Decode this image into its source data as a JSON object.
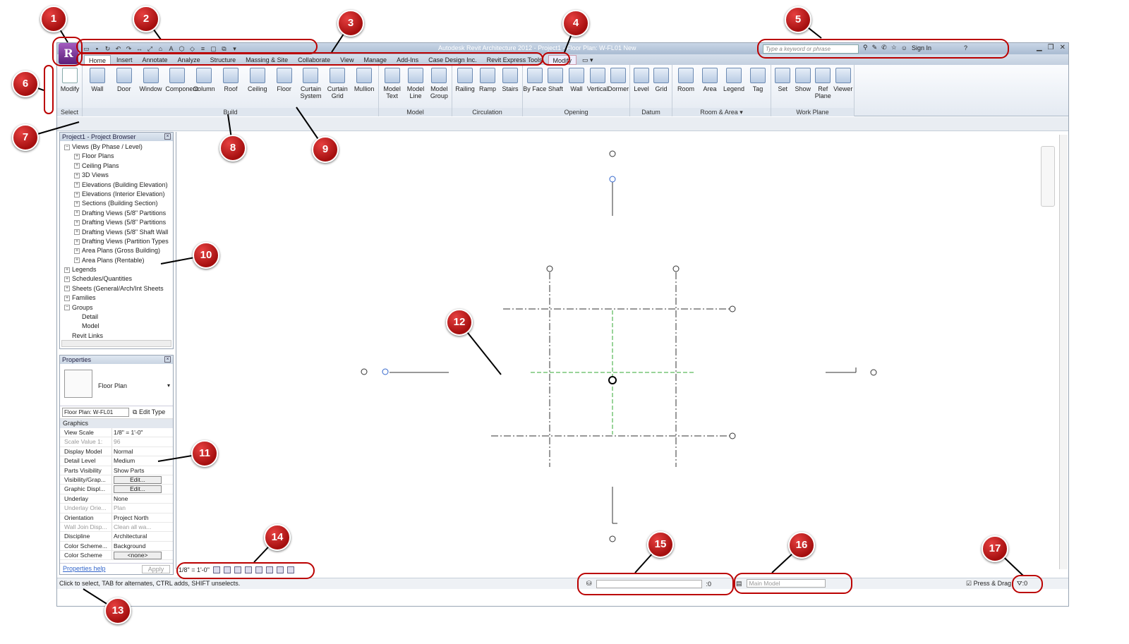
{
  "window": {
    "title": "Autodesk Revit Architecture 2012 -  Project1 - Floor Plan: W-FL01 New",
    "app_button": "R",
    "search_placeholder": "Type a keyword or phrase",
    "sign_in": "Sign In"
  },
  "ribbon_tabs": [
    "Home",
    "Insert",
    "Annotate",
    "Analyze",
    "Structure",
    "Massing & Site",
    "Collaborate",
    "View",
    "Manage",
    "Add-Ins",
    "Case Design Inc.",
    "Revit Express Tools",
    "Modify"
  ],
  "ribbon": {
    "select_tool": "Modify",
    "panels": [
      {
        "title": "Select",
        "tools": [
          "Modify"
        ]
      },
      {
        "title": "Build",
        "tools": [
          "Wall",
          "Door",
          "Window",
          "Component",
          "Column",
          "Roof",
          "Ceiling",
          "Floor",
          "Curtain System",
          "Curtain Grid",
          "Mullion"
        ]
      },
      {
        "title": "Model",
        "tools": [
          "Model Text",
          "Model Line",
          "Model Group"
        ]
      },
      {
        "title": "Circulation",
        "tools": [
          "Railing",
          "Ramp",
          "Stairs"
        ]
      },
      {
        "title": "Opening",
        "tools": [
          "By Face",
          "Shaft",
          "Wall",
          "Vertical",
          "Dormer"
        ]
      },
      {
        "title": "Datum",
        "tools": [
          "Level",
          "Grid"
        ]
      },
      {
        "title": "Room & Area ▾",
        "tools": [
          "Room",
          "Area",
          "Legend",
          "Tag"
        ]
      },
      {
        "title": "Work Plane",
        "tools": [
          "Set",
          "Show",
          "Ref Plane",
          "Viewer"
        ]
      }
    ]
  },
  "project_browser": {
    "title": "Project1 - Project Browser",
    "items": [
      {
        "label": "Views (By Phase / Level)",
        "depth": 0,
        "pm": "−"
      },
      {
        "label": "Floor Plans",
        "depth": 1,
        "pm": "+"
      },
      {
        "label": "Ceiling Plans",
        "depth": 1,
        "pm": "+"
      },
      {
        "label": "3D Views",
        "depth": 1,
        "pm": "+"
      },
      {
        "label": "Elevations (Building Elevation)",
        "depth": 1,
        "pm": "+"
      },
      {
        "label": "Elevations (Interior Elevation)",
        "depth": 1,
        "pm": "+"
      },
      {
        "label": "Sections (Building Section)",
        "depth": 1,
        "pm": "+"
      },
      {
        "label": "Drafting Views (5/8\" Partitions",
        "depth": 1,
        "pm": "+"
      },
      {
        "label": "Drafting Views (5/8\" Partitions",
        "depth": 1,
        "pm": "+"
      },
      {
        "label": "Drafting Views (5/8\" Shaft Wall",
        "depth": 1,
        "pm": "+"
      },
      {
        "label": "Drafting Views (Partition Types",
        "depth": 1,
        "pm": "+"
      },
      {
        "label": "Area Plans (Gross Building)",
        "depth": 1,
        "pm": "+"
      },
      {
        "label": "Area Plans (Rentable)",
        "depth": 1,
        "pm": "+"
      },
      {
        "label": "Legends",
        "depth": 0,
        "pm": "+"
      },
      {
        "label": "Schedules/Quantities",
        "depth": 0,
        "pm": "+"
      },
      {
        "label": "Sheets (General/Arch/Int Sheets",
        "depth": 0,
        "pm": "+"
      },
      {
        "label": "Families",
        "depth": 0,
        "pm": "+"
      },
      {
        "label": "Groups",
        "depth": 0,
        "pm": "−"
      },
      {
        "label": "Detail",
        "depth": 1,
        "pm": ""
      },
      {
        "label": "Model",
        "depth": 1,
        "pm": ""
      },
      {
        "label": "Revit Links",
        "depth": 0,
        "pm": ""
      }
    ]
  },
  "properties": {
    "title": "Properties",
    "type_name": "Floor Plan",
    "instance_selector": "Floor Plan: W-FL01",
    "edit_type": "Edit Type",
    "group": "Graphics",
    "rows": [
      {
        "k": "View Scale",
        "v": "1/8\" = 1'-0\"",
        "dim": false,
        "btn": false
      },
      {
        "k": "Scale Value    1:",
        "v": "96",
        "dim": true,
        "btn": false
      },
      {
        "k": "Display Model",
        "v": "Normal",
        "dim": false,
        "btn": false
      },
      {
        "k": "Detail Level",
        "v": "Medium",
        "dim": false,
        "btn": false
      },
      {
        "k": "Parts Visibility",
        "v": "Show Parts",
        "dim": false,
        "btn": false
      },
      {
        "k": "Visibility/Grap...",
        "v": "Edit...",
        "dim": false,
        "btn": true
      },
      {
        "k": "Graphic Displ...",
        "v": "Edit...",
        "dim": false,
        "btn": true
      },
      {
        "k": "Underlay",
        "v": "None",
        "dim": false,
        "btn": false
      },
      {
        "k": "Underlay Orie...",
        "v": "Plan",
        "dim": true,
        "btn": false
      },
      {
        "k": "Orientation",
        "v": "Project North",
        "dim": false,
        "btn": false
      },
      {
        "k": "Wall Join Disp...",
        "v": "Clean all wa...",
        "dim": true,
        "btn": false
      },
      {
        "k": "Discipline",
        "v": "Architectural",
        "dim": false,
        "btn": false
      },
      {
        "k": "Color Scheme...",
        "v": "Background",
        "dim": false,
        "btn": false
      },
      {
        "k": "Color Scheme",
        "v": "<none>",
        "dim": false,
        "btn": true
      }
    ],
    "help_link": "Properties help",
    "apply": "Apply"
  },
  "view_control": {
    "scale": "1/8\" = 1'-0\""
  },
  "status": {
    "message": "Click to select, TAB for alternates, CTRL adds, SHIFT unselects.",
    "worksets_count": ":0",
    "design_option": "Main Model",
    "press_drag": "Press & Drag",
    "filter_count": ":0"
  },
  "callouts": [
    "1",
    "2",
    "3",
    "4",
    "5",
    "6",
    "7",
    "8",
    "9",
    "10",
    "11",
    "12",
    "13",
    "14",
    "15",
    "16",
    "17"
  ],
  "colors": {
    "callout": "#c41a1a",
    "ring": "#b00000"
  }
}
